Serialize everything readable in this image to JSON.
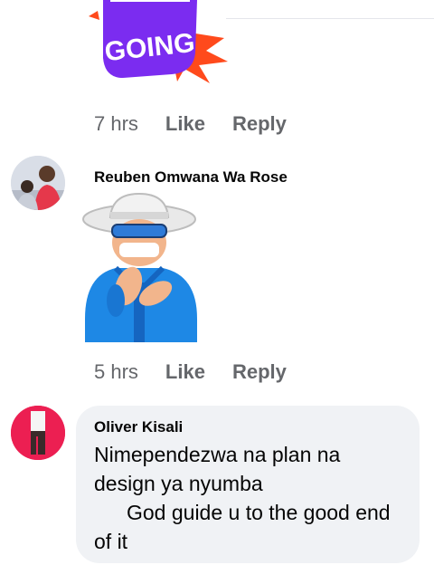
{
  "comments": [
    {
      "sticker_text": "GOING",
      "time": "7 hrs",
      "like_label": "Like",
      "reply_label": "Reply"
    },
    {
      "author": "Reuben Omwana Wa Rose",
      "time": "5 hrs",
      "like_label": "Like",
      "reply_label": "Reply"
    },
    {
      "author": "Oliver Kisali",
      "text_lines": [
        "Nimependezwa na plan na",
        "design ya nyumba",
        "God guide u to the good end",
        "of it"
      ]
    }
  ],
  "colors": {
    "meta_text": "#65676b",
    "bubble_bg": "#f0f2f5",
    "sticker_purple": "#7b2cf0",
    "sticker_orange": "#ff4a1c",
    "jacket_blue": "#1e88e5"
  }
}
